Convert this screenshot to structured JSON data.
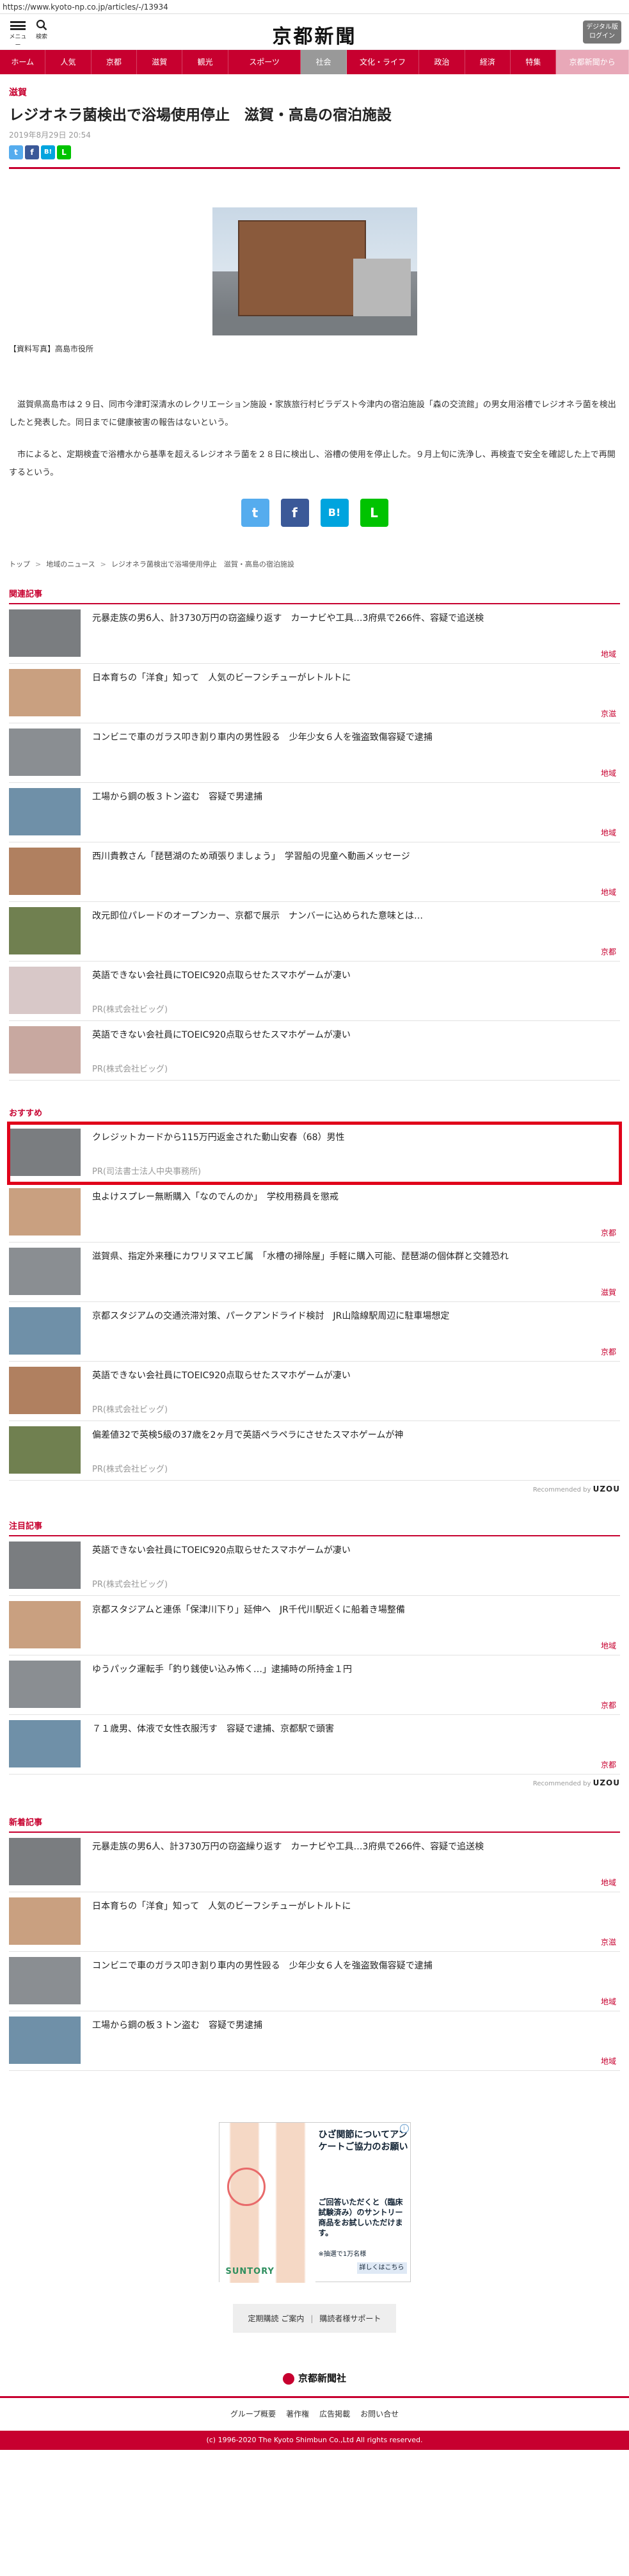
{
  "url": "https://www.kyoto-np.co.jp/articles/-/13934",
  "header": {
    "menu_label": "メニュー",
    "search_label": "検索",
    "logo": "京都新聞",
    "digital_line1": "デジタル版",
    "digital_line2": "ログイン"
  },
  "nav": [
    "ホーム",
    "人気",
    "京都",
    "滋賀",
    "観光",
    "スポーツ",
    "社会",
    "文化・ライフ",
    "政治",
    "経済",
    "特集",
    "京都新聞から"
  ],
  "article": {
    "category": "滋賀",
    "title": "レジオネラ菌検出で浴場使用停止　滋賀・高島の宿泊施設",
    "date": "2019年8月29日 20:54",
    "caption": "【資料写真】高島市役所",
    "paragraphs": [
      "滋賀県高島市は２９日、同市今津町深清水のレクリエーション施設・家族旅行村ビラデスト今津内の宿泊施設「森の交流館」の男女用浴槽でレジオネラ菌を検出したと発表した。同日までに健康被害の報告はないという。",
      "市によると、定期検査で浴槽水から基準を超えるレジオネラ菌を２８日に検出し、浴槽の使用を停止した。９月上旬に洗浄し、再検査で安全を確認した上で再開するという。"
    ]
  },
  "share": {
    "twitter": "t",
    "facebook": "f",
    "hatena": "B!",
    "line": "L"
  },
  "breadcrumb": [
    "トップ",
    "地域のニュース",
    "レジオネラ菌検出で浴場使用停止　滋賀・高島の宿泊施設"
  ],
  "related": {
    "heading": "関連記事",
    "items": [
      {
        "title": "元暴走族の男6人、計3730万円の窃盗繰り返す　カーナビや工具…3府県で266件、容疑で追送検",
        "cat": "地域",
        "sub": ""
      },
      {
        "title": "日本育ちの「洋食」知って　人気のビーフシチューがレトルトに",
        "cat": "京滋",
        "sub": ""
      },
      {
        "title": "コンビニで車のガラス叩き割り車内の男性殴る　少年少女６人を強盗致傷容疑で逮捕",
        "cat": "地域",
        "sub": ""
      },
      {
        "title": "工場から鋼の板３トン盗む　容疑で男逮捕",
        "cat": "地域",
        "sub": ""
      },
      {
        "title": "西川貴教さん「琵琶湖のため頑張りましょう」　学習船の児童へ動画メッセージ",
        "cat": "地域",
        "sub": ""
      },
      {
        "title": "改元即位パレードのオープンカー、京都で展示　ナンバーに込められた意味とは…",
        "cat": "京都",
        "sub": ""
      },
      {
        "title": "英語できない会社員にTOEIC920点取らせたスマホゲームが凄い",
        "cat": "",
        "sub": "PR(株式会社ビッグ)"
      },
      {
        "title": "英語できない会社員にTOEIC920点取らせたスマホゲームが凄い",
        "cat": "",
        "sub": "PR(株式会社ビッグ)"
      }
    ]
  },
  "recommend": {
    "heading": "おすすめ",
    "items": [
      {
        "title": "クレジットカードから115万円返金された動山安春（68）男性",
        "cat": "",
        "sub": "PR(司法書士法人中央事務所)"
      },
      {
        "title": "虫よけスプレー無断購入「なのでんのか」　学校用務員を懲戒",
        "cat": "京都",
        "sub": ""
      },
      {
        "title": "滋賀県、指定外来種にカワリヌマエビ属　「水槽の掃除屋」手軽に購入可能、琵琶湖の個体群と交雑恐れ",
        "cat": "滋賀",
        "sub": ""
      },
      {
        "title": "京都スタジアムの交通渋滞対策、パークアンドライド検討　JR山陰線駅周辺に駐車場想定",
        "cat": "京都",
        "sub": ""
      },
      {
        "title": "英語できない会社員にTOEIC920点取らせたスマホゲームが凄い",
        "cat": "",
        "sub": "PR(株式会社ビッグ)"
      },
      {
        "title": "偏差値32で英検5級の37歳を2ヶ月で英語ペラペラにさせたスマホゲームが神",
        "cat": "",
        "sub": "PR(株式会社ビッグ)"
      }
    ],
    "recommended_label": "Recommended by",
    "recommended_brand": "UZOU"
  },
  "attention": {
    "heading": "注目記事",
    "items": [
      {
        "title": "英語できない会社員にTOEIC920点取らせたスマホゲームが凄い",
        "cat": "",
        "sub": "PR(株式会社ビッグ)"
      },
      {
        "title": "京都スタジアムと連係「保津川下り」延伸へ　JR千代川駅近くに船着き場整備",
        "cat": "地域",
        "sub": ""
      },
      {
        "title": "ゆうパック運転手「釣り銭使い込み怖く…」逮捕時の所持金１円",
        "cat": "京都",
        "sub": ""
      },
      {
        "title": "７１歳男、体液で女性衣服汚す　容疑で逮捕、京都駅で頭害",
        "cat": "京都",
        "sub": ""
      }
    ],
    "recommended_label": "Recommended by",
    "recommended_brand": "UZOU"
  },
  "newest": {
    "heading": "新着記事",
    "items": [
      {
        "title": "元暴走族の男6人、計3730万円の窃盗繰り返す　カーナビや工具…3府県で266件、容疑で追送検",
        "cat": "地域",
        "sub": ""
      },
      {
        "title": "日本育ちの「洋食」知って　人気のビーフシチューがレトルトに",
        "cat": "京滋",
        "sub": ""
      },
      {
        "title": "コンビニで車のガラス叩き割り車内の男性殴る　少年少女６人を強盗致傷容疑で逮捕",
        "cat": "地域",
        "sub": ""
      },
      {
        "title": "工場から鋼の板３トン盗む　容疑で男逮捕",
        "cat": "地域",
        "sub": ""
      }
    ]
  },
  "ad": {
    "title": "ひざ関節についてアンケートご協力のお願い",
    "body": "ご回答いただくと（臨床試験済み）のサントリー商品をお試しいただけます。",
    "note": "※抽選で1万名様",
    "button": "詳しくはこちら",
    "brand": "SUNTORY"
  },
  "footer": {
    "links_box": [
      "定期購読 ご案内",
      "購読者様サポート"
    ],
    "logo": "京都新聞社",
    "links": [
      "グループ概要",
      "著作権",
      "広告掲載",
      "お問い合せ"
    ],
    "copyright": "(c) 1996-2020 The Kyoto Shimbun Co.,Ltd All rights reserved."
  },
  "colors": {
    "brand": "#c7002f",
    "nav_active": "#999999",
    "highlight": "#e0001a"
  }
}
